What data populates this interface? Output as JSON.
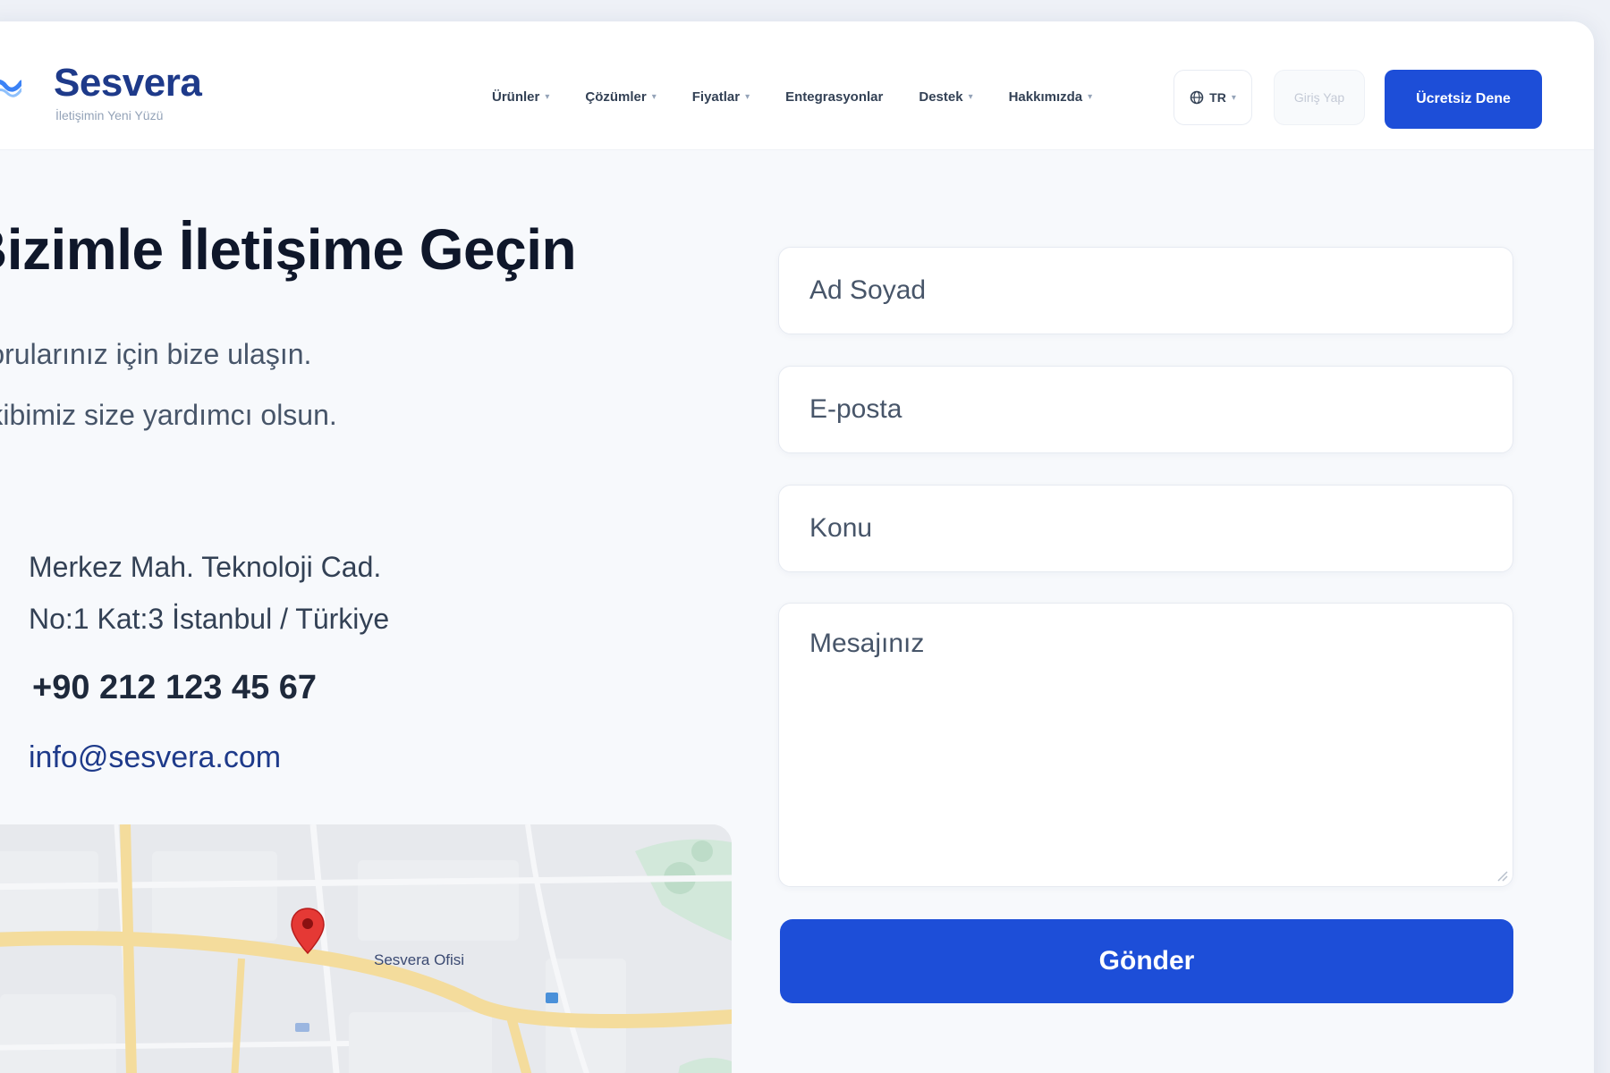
{
  "colors": {
    "primary": "#1d4ed8",
    "brand_navy": "#1e3a8a",
    "page_bg": "#f7f9fc",
    "map_pin": "#e53935"
  },
  "header": {
    "logo": {
      "name": "Sesvera",
      "tagline": "İletişimin Yeni Yüzü",
      "icon": "logo-wave-icon"
    },
    "nav": [
      {
        "label": "Ürünler",
        "has_dropdown": true
      },
      {
        "label": "Çözümler",
        "has_dropdown": true
      },
      {
        "label": "Fiyatlar",
        "has_dropdown": true
      },
      {
        "label": "Entegrasyonlar",
        "has_dropdown": false
      },
      {
        "label": "Destek",
        "has_dropdown": true
      },
      {
        "label": "Hakkımızda",
        "has_dropdown": true
      }
    ],
    "language": {
      "label": "TR",
      "icon": "globe-icon"
    },
    "login_label": "Giriş Yap",
    "cta_label": "Ücretsiz Dene"
  },
  "contact": {
    "title": "Bizimle İletişime Geçin",
    "lead_1": "Sorularınız için bize ulaşın.",
    "lead_2": "Ekibimiz size yardımcı olsun.",
    "address_1": "Merkez Mah. Teknoloji Cad.",
    "address_2": "No:1 Kat:3 İstanbul / Türkiye",
    "phone": "+90 212 123 45 67",
    "email": "info@sesvera.com",
    "map": {
      "marker_label": "Sesvera Ofisi",
      "pin_icon": "map-pin-icon"
    }
  },
  "form": {
    "name_placeholder": "Ad Soyad",
    "email_placeholder": "E-posta",
    "subject_placeholder": "Konu",
    "message_placeholder": "Mesajınız",
    "submit_label": "Gönder"
  }
}
